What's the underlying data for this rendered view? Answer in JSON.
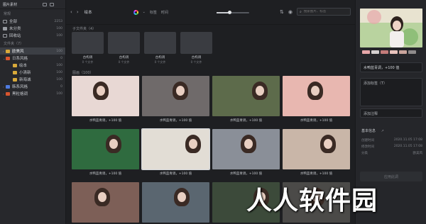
{
  "app": {
    "title": "图片素材"
  },
  "sidebar": {
    "section_title": "常规",
    "items": [
      {
        "label": "全部",
        "count": "2253"
      },
      {
        "label": "未分类",
        "count": "100"
      },
      {
        "label": "回收站",
        "count": "100"
      }
    ],
    "folders_title": "文件夹（7）",
    "folders": [
      {
        "label": "欧美风",
        "count": "100",
        "active": true,
        "color": "#d8a93a"
      },
      {
        "label": "日系风格",
        "count": "0",
        "color": "#d8552f"
      },
      {
        "label": "绘本",
        "count": "100",
        "color": "#d8a93a"
      },
      {
        "label": "小清新",
        "count": "100",
        "color": "#d8a93a"
      },
      {
        "label": "新海诚",
        "count": "100",
        "color": "#d8a93a"
      },
      {
        "label": "韩系风格",
        "count": "0",
        "color": "#4f7be0"
      },
      {
        "label": "黑粒格调",
        "count": "100",
        "color": "#d8552f"
      }
    ]
  },
  "toolbar": {
    "title": "绘本",
    "tag_label": "标签",
    "time_label": "时间",
    "search_placeholder": "搜索图片、标签"
  },
  "subfolders": {
    "title": "子文件夹（4）",
    "items": [
      {
        "name": "古构调",
        "count": "0 个文件"
      },
      {
        "name": "古构调",
        "count": "0 个文件"
      },
      {
        "name": "古构调",
        "count": "0 个文件"
      },
      {
        "name": "古构调",
        "count": "0 个文件"
      }
    ]
  },
  "images": {
    "title": "图画（100）",
    "caption": "水鸭蓝青调，+100 值",
    "items": [
      {
        "caption": "水鸭蓝青调，+100 值",
        "bg": "#e8d8d4",
        "selected": false
      },
      {
        "caption": "水鸭蓝青调，+100 值",
        "bg": "#6f6a6a",
        "selected": false
      },
      {
        "caption": "水鸭蓝青调，+100 值",
        "bg": "#5d6b4b",
        "selected": false
      },
      {
        "caption": "水鸭蓝青调，+100 值",
        "bg": "#e8b7b0",
        "selected": false
      },
      {
        "caption": "水鸭蓝青调，+100 值",
        "bg": "#2f6b3f",
        "selected": false
      },
      {
        "caption": "水鸭蓝青调，+100 值",
        "bg": "#e2ddd5",
        "selected": true
      },
      {
        "caption": "水鸭蓝青调，+100 值",
        "bg": "#8a8f98",
        "selected": false
      },
      {
        "caption": "水鸭蓝青调，+100 值",
        "bg": "#c9b6a8",
        "selected": false
      },
      {
        "caption": "",
        "bg": "#7d5f57",
        "selected": false
      },
      {
        "caption": "",
        "bg": "#5a6670",
        "selected": false
      },
      {
        "caption": "",
        "bg": "#3c4a3a",
        "selected": false
      },
      {
        "caption": "",
        "bg": "#4b4a48",
        "selected": false
      }
    ]
  },
  "right_panel": {
    "title_value": "水鸭蓝青调，+100 值",
    "tag_button": "添加标签（T）",
    "note_button": "添加注释",
    "info_title": "基本信息",
    "info": [
      {
        "key": "创建时间",
        "value": "2020.11.05 17:08"
      },
      {
        "key": "修改时间",
        "value": "2020.11.05 17:08"
      },
      {
        "key": "分类",
        "value": "欧美风"
      }
    ],
    "bottom_button": "应用此调",
    "swatches": [
      "#e7a7a9",
      "#d4cfcf",
      "#c37b7a",
      "#e9c3bd",
      "#caa59c",
      "#8f8b8b"
    ]
  },
  "watermark": "人人软件园"
}
